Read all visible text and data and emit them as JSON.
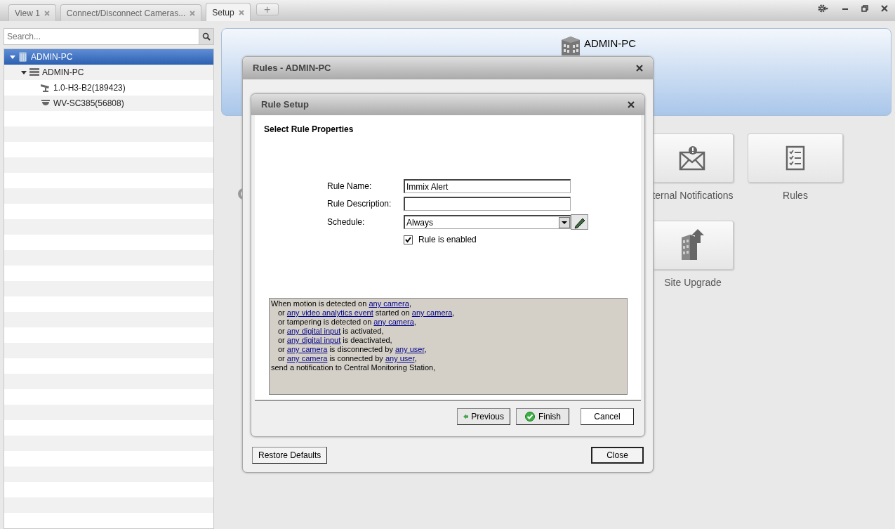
{
  "tabs": [
    {
      "label": "View 1",
      "selected": false
    },
    {
      "label": "Connect/Disconnect Cameras...",
      "selected": false
    },
    {
      "label": "Setup",
      "selected": true
    }
  ],
  "new_tab": "+",
  "sidebar": {
    "search": {
      "placeholder": "Search..."
    },
    "tree": [
      {
        "label": "ADMIN-PC",
        "kind": "site",
        "selected": true,
        "expanded": true,
        "children": [
          {
            "label": "ADMIN-PC",
            "kind": "server",
            "selected": false,
            "expanded": true,
            "children": [
              {
                "label": "1.0-H3-B2(189423)",
                "kind": "bullet",
                "selected": false
              },
              {
                "label": "WV-SC385(56808)",
                "kind": "dome",
                "selected": false
              }
            ]
          }
        ]
      }
    ]
  },
  "header": {
    "title": "ADMIN-PC"
  },
  "tiles": [
    {
      "label": "ternal Notifications",
      "kind": "notifications"
    },
    {
      "label": "Rules",
      "kind": "rules"
    },
    {
      "label": "Site Upgrade",
      "kind": "upgrade"
    }
  ],
  "rules_dialog": {
    "title": "Rules - ADMIN-PC",
    "buttons": [
      {
        "label": "Restore Defaults",
        "default": false
      },
      {
        "label": "Close",
        "default": true
      }
    ]
  },
  "rule_setup": {
    "title": "Rule Setup",
    "heading": "Select Rule Properties",
    "fields": [
      {
        "kind": "text",
        "label": "Rule Name:",
        "value": "Immix Alert"
      },
      {
        "kind": "text",
        "label": "Rule Description:"
      },
      {
        "kind": "select",
        "label": "Schedule:",
        "value": "Always"
      }
    ],
    "enabled": {
      "label": "Rule is enabled",
      "checked": true
    },
    "rule_lines": [
      {
        "kind": "trigger",
        "segments": [
          {
            "text": "When motion is detected on ",
            "link": false
          },
          {
            "text": "any camera",
            "link": true
          },
          {
            "text": ",",
            "link": false
          }
        ]
      },
      {
        "kind": "alternative",
        "segments": [
          {
            "text": "or ",
            "link": false
          },
          {
            "text": "any video analytics event",
            "link": true
          },
          {
            "text": " started on ",
            "link": false
          },
          {
            "text": "any camera",
            "link": true
          },
          {
            "text": ",",
            "link": false
          }
        ]
      },
      {
        "kind": "alternative",
        "segments": [
          {
            "text": "or tampering is detected on ",
            "link": false
          },
          {
            "text": "any camera",
            "link": true
          },
          {
            "text": ",",
            "link": false
          }
        ]
      },
      {
        "kind": "alternative",
        "segments": [
          {
            "text": "or ",
            "link": false
          },
          {
            "text": "any digital input",
            "link": true
          },
          {
            "text": " is activated,",
            "link": false
          }
        ]
      },
      {
        "kind": "alternative",
        "segments": [
          {
            "text": "or ",
            "link": false
          },
          {
            "text": "any digital input",
            "link": true
          },
          {
            "text": " is deactivated,",
            "link": false
          }
        ]
      },
      {
        "kind": "alternative",
        "segments": [
          {
            "text": "or ",
            "link": false
          },
          {
            "text": "any camera",
            "link": true
          },
          {
            "text": " is disconnected by ",
            "link": false
          },
          {
            "text": "any user",
            "link": true
          },
          {
            "text": ",",
            "link": false
          }
        ]
      },
      {
        "kind": "alternative",
        "segments": [
          {
            "text": "or ",
            "link": false
          },
          {
            "text": "any camera",
            "link": true
          },
          {
            "text": " is connected by ",
            "link": false
          },
          {
            "text": "any user",
            "link": true
          },
          {
            "text": ",",
            "link": false
          }
        ]
      },
      {
        "kind": "action",
        "segments": [
          {
            "text": "send a notification to Central Monitoring Station,",
            "link": false
          }
        ]
      }
    ],
    "buttons": [
      {
        "label": "Previous",
        "kind": "previous"
      },
      {
        "label": "Finish",
        "kind": "finish"
      },
      {
        "label": "Cancel",
        "kind": "cancel"
      }
    ]
  }
}
